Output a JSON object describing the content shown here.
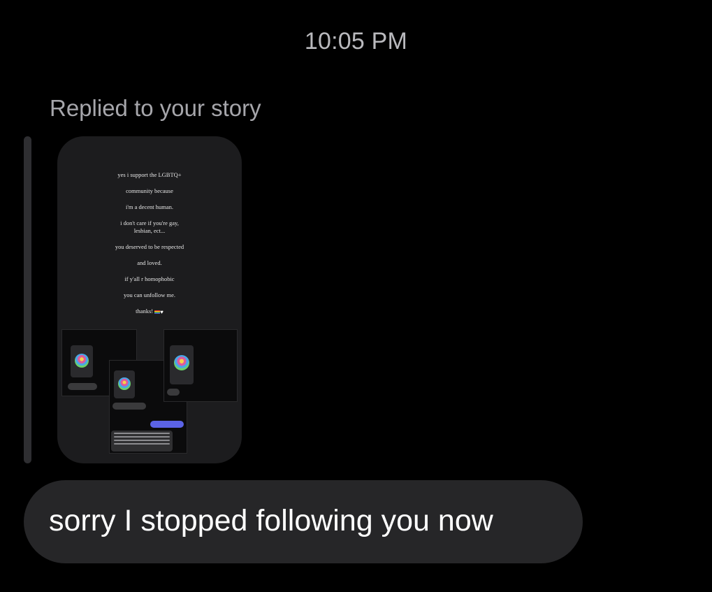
{
  "thread": {
    "timestamp": "10:05 PM",
    "reply_label": "Replied to your story",
    "message": "sorry I stopped following you now"
  },
  "story": {
    "lines": [
      "yes i support the LGBTQ+",
      "community because",
      "i'm a decent human.",
      "i don't care if you're gay,",
      "lesbian, ect...",
      "you deserved to be respected",
      "and loved.",
      "if y'all r homophobic",
      "you can unfollow me.",
      "thanks!"
    ]
  },
  "colors": {
    "background": "#000000",
    "bubble": "#262628",
    "story_card": "#1c1c1e",
    "reply_bar": "#2e2e31",
    "meta_text": "#a6a6ab",
    "accent_blue": "#5b63e6"
  }
}
